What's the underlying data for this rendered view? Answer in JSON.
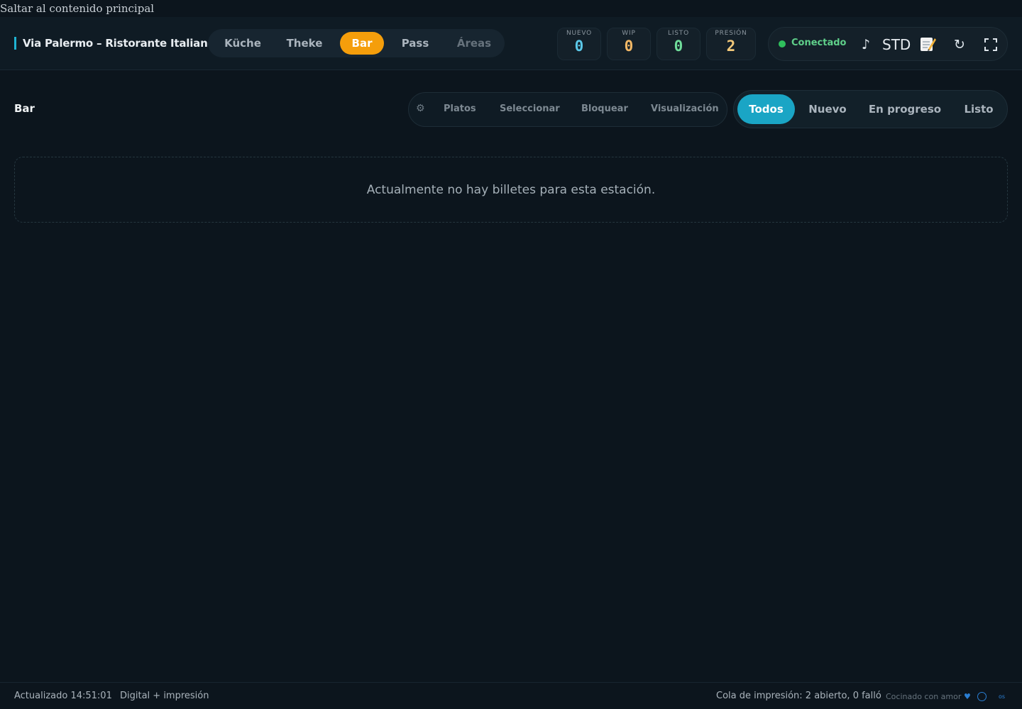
{
  "skip_link": "Saltar al contenido principal",
  "header": {
    "brand": "Via Palermo – Ristorante Italiano",
    "stations": [
      {
        "label": "Küche",
        "active": false
      },
      {
        "label": "Theke",
        "active": false
      },
      {
        "label": "Bar",
        "active": true
      },
      {
        "label": "Pass",
        "active": false
      },
      {
        "label": "Áreas",
        "active": false
      }
    ],
    "counters": [
      {
        "label": "NUEVO",
        "value": "0",
        "color": "#5bc8e8"
      },
      {
        "label": "WIP",
        "value": "0",
        "color": "#f2b866"
      },
      {
        "label": "LISTO",
        "value": "0",
        "color": "#6fdc9a"
      },
      {
        "label": "PRESIÓN",
        "value": "2",
        "color": "#f3c97a"
      }
    ],
    "status": {
      "text": "Conectado",
      "color": "#2fbf5c",
      "mode": "STD",
      "icons": [
        "music-note-icon",
        "notes-icon",
        "refresh-icon",
        "fullscreen-icon"
      ]
    }
  },
  "main": {
    "title": "Bar",
    "tools": {
      "icon": "gear-icon",
      "items": [
        "Platos",
        "Seleccionar",
        "Bloquear",
        "Visualización"
      ]
    },
    "filters": [
      {
        "label": "Todos",
        "active": true
      },
      {
        "label": "Nuevo",
        "active": false
      },
      {
        "label": "En progreso",
        "active": false
      },
      {
        "label": "Listo",
        "active": false
      }
    ],
    "empty_message": "Actualmente no hay billetes para esta estación."
  },
  "footer": {
    "updated": "Actualizado 14:51:01",
    "mode": "Digital + impresión",
    "print_queue": "Cola de impresión: 2 abierto, 0 falló",
    "credit": "Cocinado con amor",
    "credit_heart": "♥",
    "os_mark": "os"
  },
  "colors": {
    "accent": "#1aa5c5",
    "station_active": "#f59e0b",
    "background": "#0c151d"
  }
}
